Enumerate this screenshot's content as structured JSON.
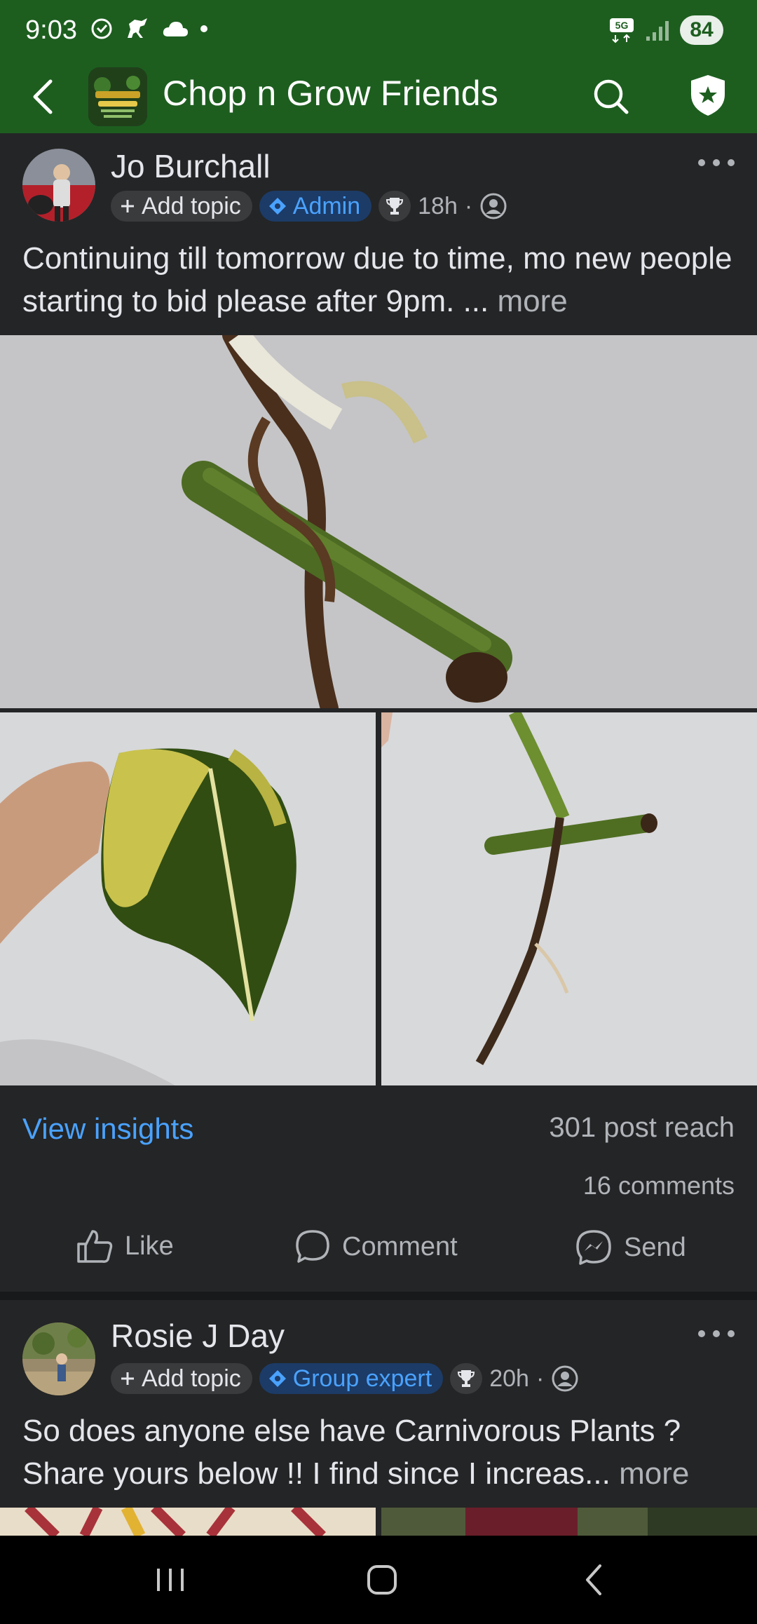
{
  "status_bar": {
    "time": "9:03",
    "network": "5G",
    "battery": "84"
  },
  "header": {
    "title": "Chop n Grow Friends",
    "logo_icon": "group-logo-image",
    "search_icon": "search-icon",
    "shield_icon": "shield-star-icon"
  },
  "post1": {
    "author": "Jo Burchall",
    "add_topic": "Add topic",
    "role": "Admin",
    "time": "18h",
    "separator": "·",
    "text": "Continuing till tomorrow due to time,  mo new people starting to bid please after 9pm. ...",
    "more": "more",
    "view_insights": "View insights",
    "reach": "301 post reach",
    "comments": "16 comments",
    "actions": {
      "like": "Like",
      "comment": "Comment",
      "send": "Send"
    }
  },
  "post2": {
    "author": "Rosie J Day",
    "add_topic": "Add topic",
    "role": "Group expert",
    "time": "20h",
    "separator": "·",
    "text": "So does anyone else have Carnivorous Plants ? Share yours below !! I find since I increas...",
    "more": "more"
  },
  "colors": {
    "header_bg": "#1d5e1f",
    "feed_bg": "#242526",
    "link_blue": "#4aa2ff",
    "role_chip_bg": "#1c3b67"
  }
}
